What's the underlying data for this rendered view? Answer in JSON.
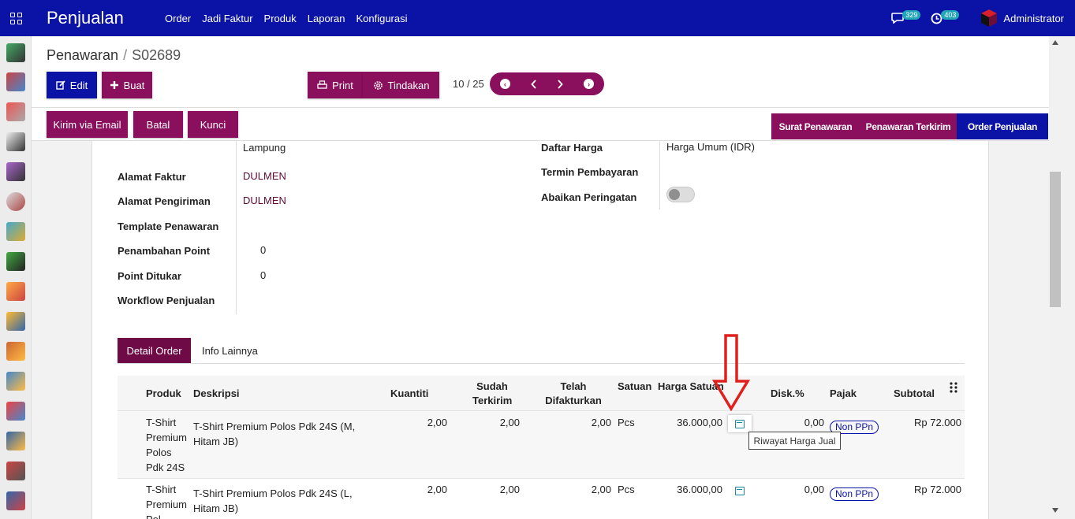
{
  "app": {
    "title": "Penjualan",
    "menu": [
      "Order",
      "Jadi Faktur",
      "Produk",
      "Laporan",
      "Konfigurasi"
    ],
    "messages_count": "329",
    "activities_count": "403",
    "user": "Administrator"
  },
  "breadcrumb": {
    "parent": "Penawaran",
    "separator": "/",
    "current": "S02689"
  },
  "buttons": {
    "edit": "Edit",
    "create": "Buat",
    "print": "Print",
    "action": "Tindakan",
    "send_email": "Kirim via Email",
    "cancel": "Batal",
    "lock": "Kunci"
  },
  "pager": {
    "text": "10 / 25"
  },
  "stages": [
    "Surat Penawaran",
    "Penawaran Terkirim",
    "Order Penjualan"
  ],
  "form": {
    "partial_address": "Lampung",
    "invoice_address_label": "Alamat Faktur",
    "invoice_address_value": "DULMEN",
    "shipping_address_label": "Alamat Pengiriman",
    "shipping_address_value": "DULMEN",
    "template_label": "Template Penawaran",
    "points_added_label": "Penambahan Point",
    "points_added_value": "0",
    "points_redeemed_label": "Point Ditukar",
    "points_redeemed_value": "0",
    "workflow_label": "Workflow Penjualan",
    "pricelist_label": "Daftar Harga",
    "pricelist_value": "Harga Umum (IDR)",
    "payment_terms_label": "Termin Pembayaran",
    "ignore_warning_label": "Abaikan Peringatan"
  },
  "tabs": [
    "Detail Order",
    "Info Lainnya"
  ],
  "table": {
    "headers": {
      "product": "Produk",
      "description": "Deskripsi",
      "quantity": "Kuantiti",
      "delivered_1": "Sudah",
      "delivered_2": "Terkirim",
      "invoiced_1": "Telah",
      "invoiced_2": "Difakturkan",
      "uom": "Satuan",
      "price": "Harga Satuan",
      "discount": "Disk.%",
      "tax": "Pajak",
      "subtotal": "Subtotal"
    },
    "rows": [
      {
        "product": [
          "T-Shirt",
          "Premium",
          "Polos",
          "Pdk 24S"
        ],
        "description": [
          "T-Shirt Premium Polos Pdk 24S (M,",
          "Hitam JB)"
        ],
        "quantity": "2,00",
        "delivered": "2,00",
        "invoiced": "2,00",
        "uom": "Pcs",
        "price": "36.000,00",
        "discount": "0,00",
        "tax": "Non PPn",
        "subtotal": "Rp 72.000"
      },
      {
        "product": [
          "T-Shirt",
          "Premium",
          "Pol"
        ],
        "description": [
          "T-Shirt Premium Polos Pdk 24S (L,",
          "Hitam JB)"
        ],
        "quantity": "2,00",
        "delivered": "2,00",
        "invoiced": "2,00",
        "uom": "Pcs",
        "price": "36.000,00",
        "discount": "0,00",
        "tax": "Non PPn",
        "subtotal": "Rp 72.000"
      }
    ]
  },
  "tooltip": "Riwayat Harga Jual",
  "colors": {
    "primary": "#0b12a6",
    "secondary": "#8a0f5c",
    "tab_active": "#6e0a45",
    "annotation": "#e0201c"
  }
}
